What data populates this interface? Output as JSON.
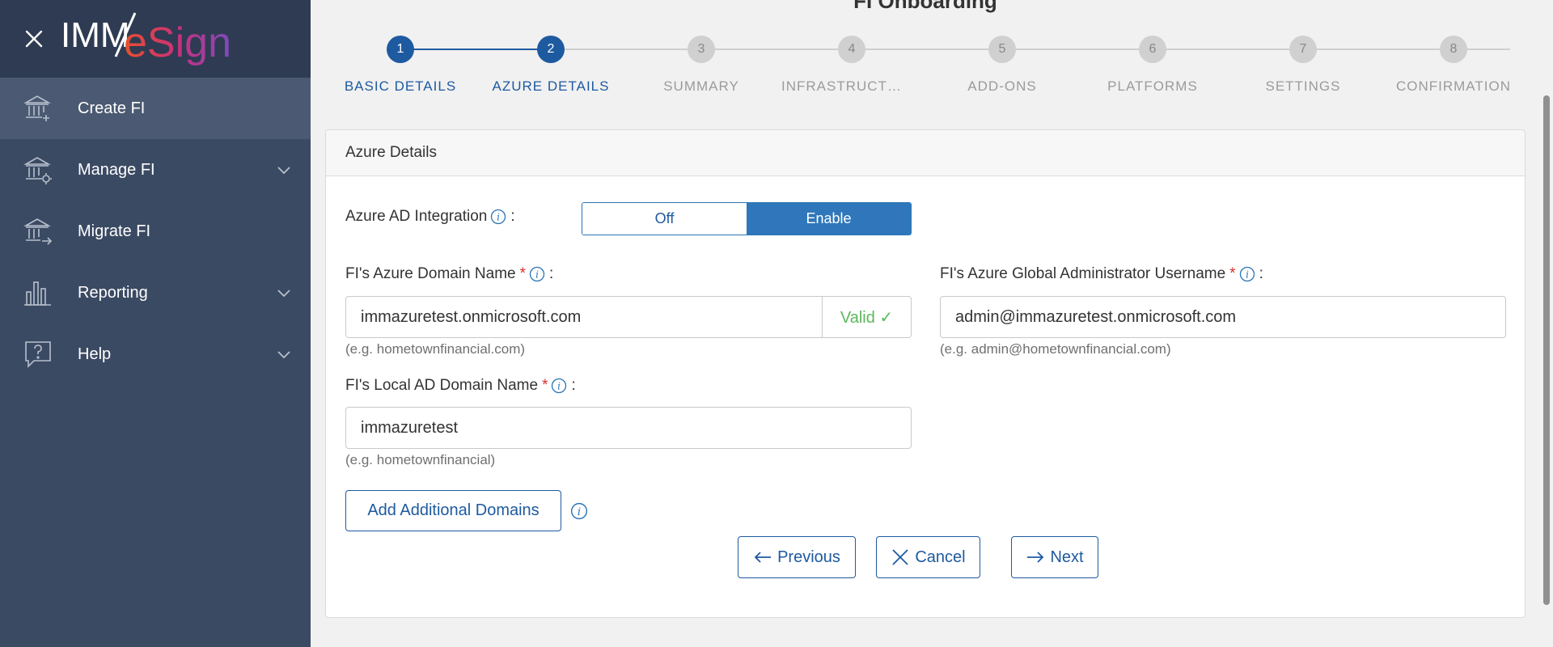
{
  "sidebar": {
    "logo_text_1": "IMM",
    "logo_text_2": "eSign",
    "items": [
      {
        "label": "Create FI",
        "icon": "bank-plus-icon"
      },
      {
        "label": "Manage FI",
        "icon": "bank-gear-icon"
      },
      {
        "label": "Migrate FI",
        "icon": "bank-arrow-icon"
      },
      {
        "label": "Reporting",
        "icon": "bar-chart-icon"
      },
      {
        "label": "Help",
        "icon": "help-bubble-icon"
      }
    ]
  },
  "page_title": "FI Onboarding",
  "steps": [
    {
      "num": "1",
      "label": "BASIC DETAILS"
    },
    {
      "num": "2",
      "label": "AZURE DETAILS"
    },
    {
      "num": "3",
      "label": "SUMMARY"
    },
    {
      "num": "4",
      "label": "INFRASTRUCTURE"
    },
    {
      "num": "5",
      "label": "ADD-ONS"
    },
    {
      "num": "6",
      "label": "PLATFORMS"
    },
    {
      "num": "7",
      "label": "SETTINGS"
    },
    {
      "num": "8",
      "label": "CONFIRMATION"
    }
  ],
  "card": {
    "title": "Azure Details",
    "ad_integration": {
      "label": "Azure AD Integration",
      "colon": ":",
      "off": "Off",
      "enable": "Enable"
    },
    "azure_domain": {
      "label": "FI's Azure Domain Name",
      "req": "*",
      "colon": ":",
      "value": "immazuretest.onmicrosoft.com",
      "valid": "Valid ✓",
      "hint": "(e.g. hometownfinancial.com)"
    },
    "admin_username": {
      "label": "FI's Azure Global Administrator Username",
      "req": "*",
      "colon": ":",
      "value": "admin@immazuretest.onmicrosoft.com",
      "hint": "(e.g. admin@hometownfinancial.com)"
    },
    "local_domain": {
      "label": "FI's Local AD Domain Name",
      "req": "*",
      "colon": ":",
      "value": "immazuretest",
      "hint": "(e.g. hometownfinancial)"
    },
    "add_domains": "Add Additional Domains",
    "previous": "Previous",
    "cancel": "Cancel",
    "next": "Next"
  },
  "colors": {
    "primary": "#1e5aa0",
    "sidebar": "#3b4a63",
    "valid": "#5cb85c",
    "required": "#d9302c"
  }
}
